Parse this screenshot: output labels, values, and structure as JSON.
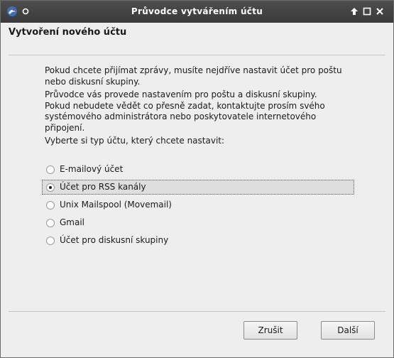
{
  "window": {
    "title": "Průvodce vytvářením účtu"
  },
  "header": {
    "title": "Vytvoření nového účtu"
  },
  "content": {
    "paragraph1": "Pokud chcete přijímat zprávy, musíte nejdříve nastavit účet pro poštu nebo diskusní skupiny.",
    "paragraph2": "Průvodce vás provede nastavením pro poštu a diskusní skupiny. Pokud nebudete vědět co přesně zadat, kontaktujte prosím svého systémového administrátora nebo poskytovatele internetového připojení.",
    "paragraph3": "Vyberte si typ účtu, který chcete nastavit:"
  },
  "account_types": {
    "selected_index": 1,
    "options": [
      {
        "label": "E-mailový účet"
      },
      {
        "label": "Účet pro RSS kanály"
      },
      {
        "label": "Unix Mailspool (Movemail)"
      },
      {
        "label": "Gmail"
      },
      {
        "label": "Účet pro diskusní skupiny"
      }
    ]
  },
  "buttons": {
    "cancel": "Zrušit",
    "next": "Další"
  },
  "icons": {
    "app": "thunderbird-app-icon",
    "pin": "sticky-pin-icon",
    "up": "arrow-up-icon",
    "maximize": "maximize-icon",
    "close": "close-icon"
  }
}
